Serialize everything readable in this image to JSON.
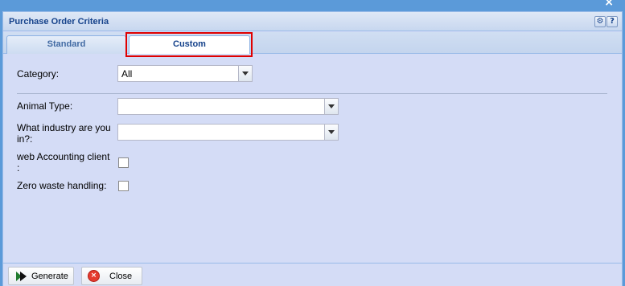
{
  "window": {
    "title": "Purchase Order Criteria",
    "close_glyph": "×",
    "tools": {
      "gear_glyph": "⚙",
      "help_glyph": "?"
    }
  },
  "tabs": [
    {
      "label": "Standard",
      "active": false
    },
    {
      "label": "Custom",
      "active": true
    }
  ],
  "form": {
    "category": {
      "label": "Category:",
      "value": "All"
    },
    "animal_type": {
      "label": "Animal Type:",
      "value": ""
    },
    "industry": {
      "label_line1": "What industry are you",
      "label_line2": "in?:",
      "value": ""
    },
    "web_accounting": {
      "label_line1": "web Accounting client",
      "label_line2": ":",
      "checked": false
    },
    "zero_waste": {
      "label": "Zero waste handling:",
      "checked": false
    }
  },
  "footer": {
    "generate_label": "Generate",
    "close_label": "Close",
    "close_glyph": "×"
  },
  "colors": {
    "highlight": "#e00000",
    "title_text": "#15428b",
    "panel_bg": "#d4dcf6"
  },
  "icons": {
    "generate": "play-arrow-icon",
    "close": "close-circle-icon",
    "gear": "gear-icon",
    "help": "help-icon",
    "combo_trigger": "chevron-down-icon"
  }
}
